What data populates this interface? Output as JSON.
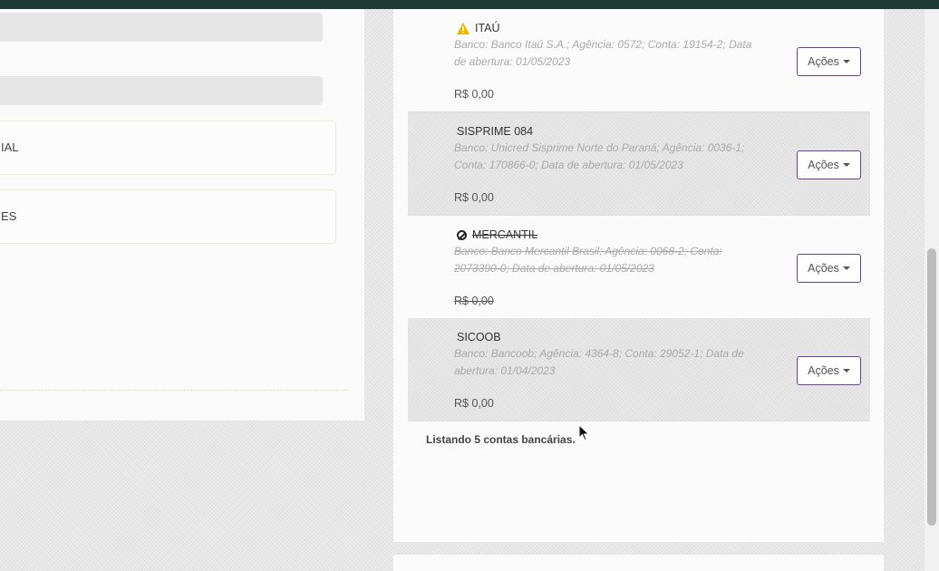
{
  "left_panel": {
    "option_1": "IAL",
    "option_2": "ES"
  },
  "accounts": [
    {
      "name": "ITAÚ",
      "icon": "warning-icon",
      "description": "Banco: Banco Itaú S.A.; Agência: 0572; Conta: 19154-2; Data de abertura: 01/05/2023",
      "balance": "R$ 0,00",
      "action": "Ações"
    },
    {
      "name": "SISPRIME 084",
      "description": "Banco: Unicred Sisprime Norte do Paraná; Agência: 0036-1; Conta: 170866-0; Data de abertura: 01/05/2023",
      "balance": "R$ 0,00",
      "action": "Ações"
    },
    {
      "name": "MERCANTIL",
      "icon": "ban-icon",
      "description": "Banco: Banco Mercantil Brasil; Agência: 0068-2; Conta: 2073390-0; Data de abertura: 01/05/2023",
      "balance": "R$ 0,00",
      "action": "Ações"
    },
    {
      "name": "SICOOB",
      "description": "Banco: Bancoob; Agência: 4364-8; Conta: 29052-1; Data de abertura: 01/04/2023",
      "balance": "R$ 0,00",
      "action": "Ações"
    }
  ],
  "footer": "Listando 5 contas bancárias.",
  "colors": {
    "topbar": "#1f3a34",
    "button_border": "#6e3f8e",
    "warning": "#f0b400"
  }
}
